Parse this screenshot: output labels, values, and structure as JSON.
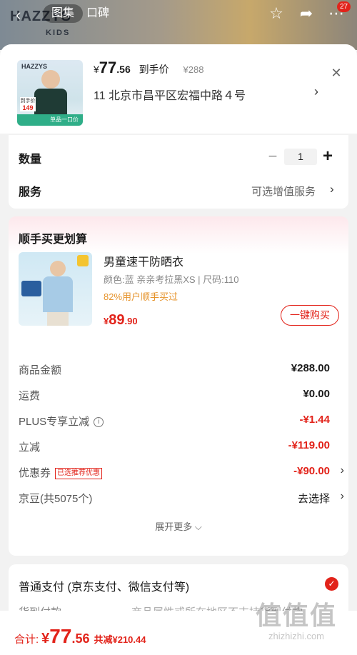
{
  "topbar": {
    "brand": "HAZZYS",
    "brand_sub": "KIDS",
    "tab_gallery": "图集",
    "tab_reviews": "口碑",
    "cart_badge": "27",
    "icons": [
      "back-icon",
      "star-icon",
      "share-icon",
      "more-icon"
    ]
  },
  "product": {
    "price_symbol": "¥",
    "price_int": "77",
    "price_dec": ".56",
    "price_label": "到手价",
    "original_price": "¥288",
    "address": "11  北京市昌平区宏福中路４号",
    "thumb_brand": "HAZZYS",
    "thumb_tag_label": "到手价",
    "thumb_tag_price": "149",
    "thumb_bar_text": "单品一口价"
  },
  "quantity": {
    "label": "数量",
    "value": "1",
    "minus": "−",
    "plus": "+"
  },
  "service": {
    "label": "服务",
    "value": "可选增值服务"
  },
  "bundle": {
    "title": "顺手买更划算",
    "name": "男童速干防晒衣",
    "spec": "颜色:蓝 亲亲考拉黑XS  |  尺码:110",
    "bought": "82%用户顺手买过",
    "price_symbol": "¥",
    "price_int": "89",
    "price_dec": ".90",
    "buy_button": "一键购买"
  },
  "summary": {
    "rows": [
      {
        "label": "商品金额",
        "value": "¥288.00"
      },
      {
        "label": "运费",
        "value": "¥0.00"
      },
      {
        "label": "PLUS专享立减",
        "value": "-¥1.44"
      },
      {
        "label": "立减",
        "value": "-¥119.00"
      },
      {
        "label": "优惠券",
        "tag": "已选推荐优惠",
        "value": "-¥90.00"
      },
      {
        "label": "京豆(共5075个)",
        "value": "去选择"
      }
    ],
    "expand": "展开更多 ⌵"
  },
  "payment": {
    "title": "普通支付 (京东支付、微信支付等)",
    "cod_label": "货到付款",
    "cod_note": "商品属性或所在地区不支持货到付款"
  },
  "footer": {
    "total_label": "合计:",
    "total_symbol": "¥",
    "total_int": "77",
    "total_dec": ".56",
    "saved": "共减¥210.44"
  },
  "watermark": {
    "text": "值值值",
    "url": "zhizhizhi.com"
  },
  "colors": {
    "accent": "#e2231a",
    "bought": "#e6932b",
    "background": "#f2f2f2"
  }
}
